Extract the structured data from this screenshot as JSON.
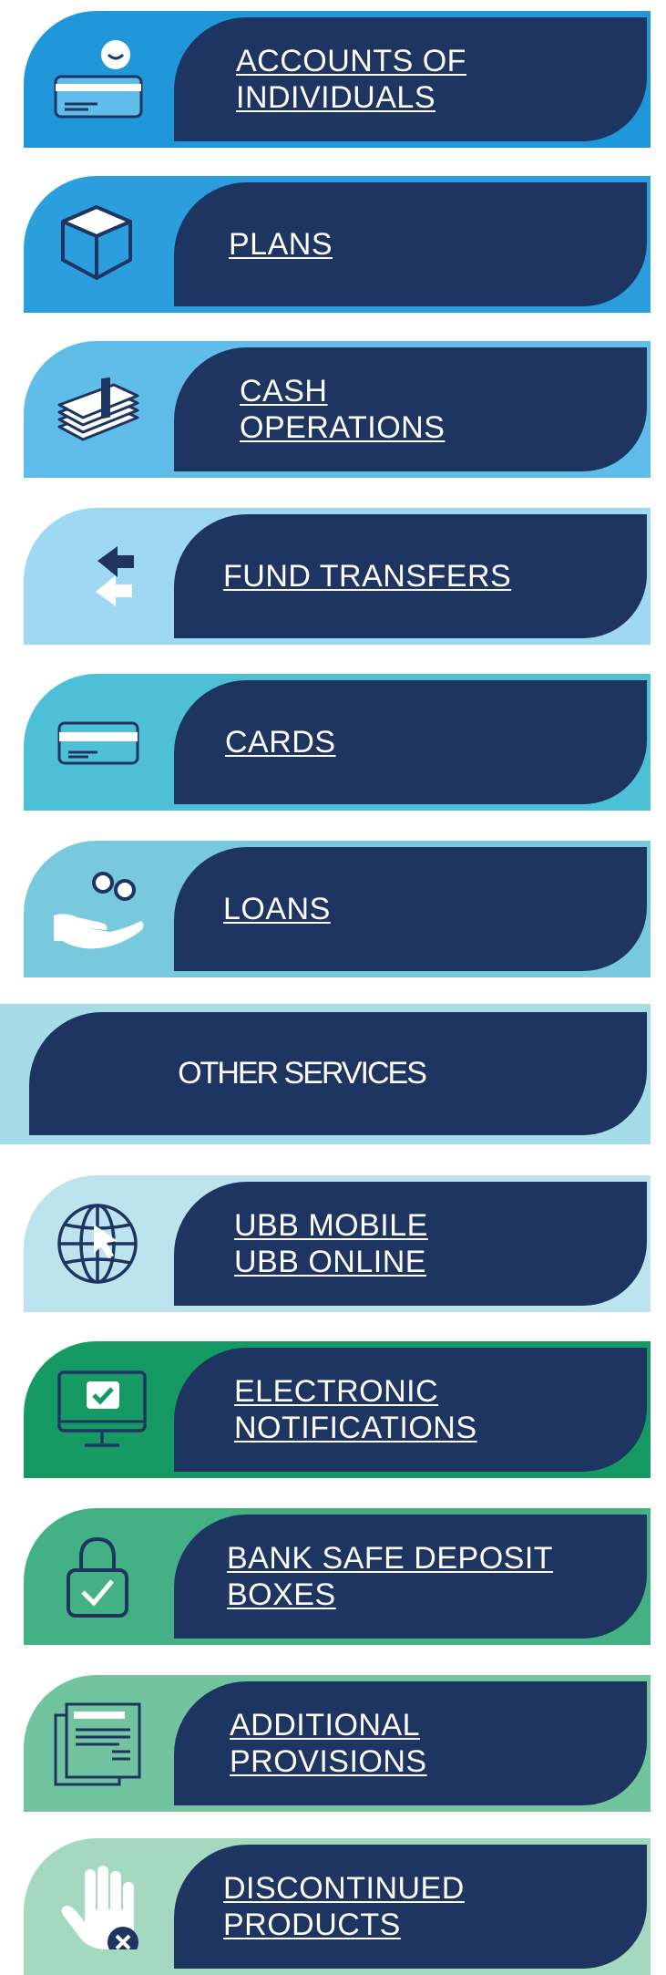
{
  "items": [
    {
      "id": "accounts",
      "lines": [
        "ACCOUNTS OF",
        "INDIVIDUALS"
      ],
      "color": "#1f97d8",
      "icon": "person-card-icon"
    },
    {
      "id": "plans",
      "lines": [
        "PLANS"
      ],
      "color": "#2b9fde",
      "icon": "open-box-icon"
    },
    {
      "id": "cash",
      "lines": [
        "CASH",
        "OPERATIONS"
      ],
      "color": "#60bde9",
      "icon": "banknotes-stack-icon"
    },
    {
      "id": "transfers",
      "lines": [
        "FUND TRANSFERS"
      ],
      "color": "#9ed8f3",
      "icon": "transfer-arrows-icon"
    },
    {
      "id": "cards",
      "lines": [
        "CARDS"
      ],
      "color": "#4dbfd6",
      "icon": "credit-card-icon"
    },
    {
      "id": "loans",
      "lines": [
        "LOANS"
      ],
      "color": "#79c9de",
      "icon": "hand-coins-icon"
    },
    {
      "id": "mobile",
      "lines": [
        "UBB MOBILE",
        "UBB ONLINE"
      ],
      "color": "#bde4ee",
      "icon": "globe-cursor-icon"
    },
    {
      "id": "notifications",
      "lines": [
        "ELECTRONIC",
        "NOTIFICATIONS"
      ],
      "color": "#169a64",
      "icon": "monitor-check-icon"
    },
    {
      "id": "safe",
      "lines": [
        "BANK SAFE DEPOSIT",
        "BOXES"
      ],
      "color": "#43b183",
      "icon": "padlock-check-icon"
    },
    {
      "id": "provisions",
      "lines": [
        "ADDITIONAL",
        "PROVISIONS"
      ],
      "color": "#72c49f",
      "icon": "documents-icon"
    },
    {
      "id": "discontinued",
      "lines": [
        "DISCONTINUED",
        "PRODUCTS"
      ],
      "color": "#a4d8bf",
      "icon": "hand-stop-icon"
    }
  ],
  "other": {
    "label": "OTHER SERVICES",
    "color": "#a6dce8"
  },
  "colors": {
    "panel": "#1e3562",
    "text": "#ffffff"
  }
}
